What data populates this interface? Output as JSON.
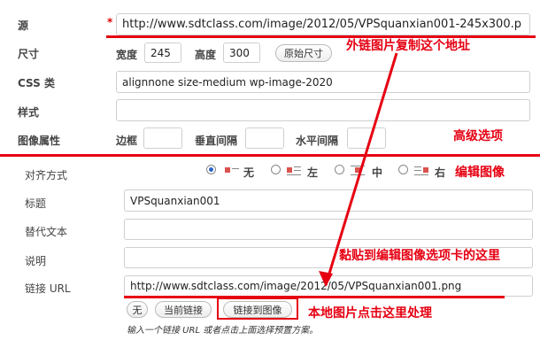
{
  "form": {
    "source": {
      "label": "源",
      "required_mark": "*",
      "value": "http://www.sdtclass.com/image/2012/05/VPSquanxian001-245x300.p"
    },
    "size": {
      "label": "尺寸",
      "width_label": "宽度",
      "width_value": "245",
      "height_label": "高度",
      "height_value": "300",
      "original_button": "原始尺寸"
    },
    "css_class": {
      "label": "CSS 类",
      "value": "alignnone size-medium wp-image-2020"
    },
    "style": {
      "label": "样式",
      "value": ""
    },
    "image_attrs": {
      "label": "图像属性",
      "border_label": "边框",
      "vspace_label": "垂直间隔",
      "hspace_label": "水平间隔"
    }
  },
  "edit": {
    "alignment": {
      "label": "对齐方式",
      "options": [
        {
          "label": "无",
          "selected": true
        },
        {
          "label": "左",
          "selected": false
        },
        {
          "label": "中",
          "selected": false
        },
        {
          "label": "右",
          "selected": false
        }
      ]
    },
    "title": {
      "label": "标题",
      "value": "VPSquanxian001"
    },
    "alt": {
      "label": "替代文本",
      "value": ""
    },
    "caption": {
      "label": "说明",
      "value": ""
    },
    "link": {
      "label": "链接 URL",
      "value": "http://www.sdtclass.com/image/2012/05/VPSquanxian001.png"
    },
    "buttons": {
      "none": "无",
      "current": "当前链接",
      "to_image": "链接到图像"
    },
    "hint": "输入一个链接 URL 或者点击上面选择预置方案。"
  },
  "annotations": {
    "copy_external": "外链图片复制这个地址",
    "advanced": "高级选项",
    "edit_image": "编辑图像",
    "paste_here": "黏贴到编辑图像选项卡的这里",
    "local_image": "本地图片点击这里处理"
  },
  "colors": {
    "annotation_red": "#e60012",
    "radio_blue": "#2a64c5"
  }
}
